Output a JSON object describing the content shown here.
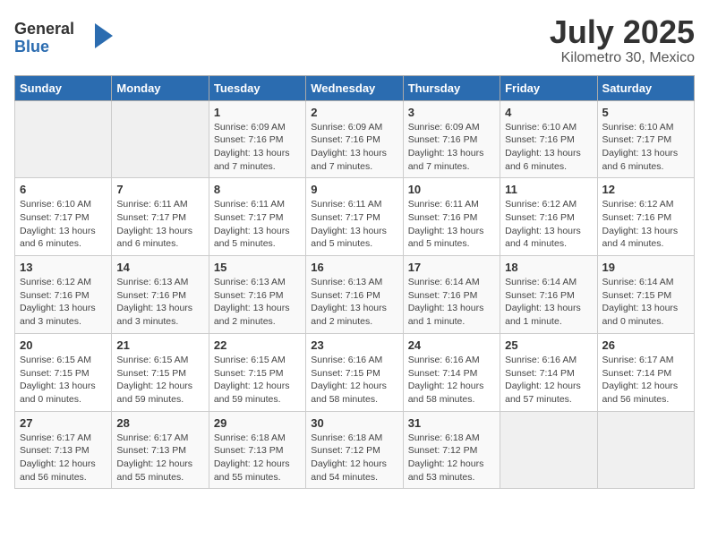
{
  "header": {
    "logo_line1": "General",
    "logo_line2": "Blue",
    "month_title": "July 2025",
    "subtitle": "Kilometro 30, Mexico"
  },
  "weekdays": [
    "Sunday",
    "Monday",
    "Tuesday",
    "Wednesday",
    "Thursday",
    "Friday",
    "Saturday"
  ],
  "weeks": [
    [
      {
        "day": "",
        "info": ""
      },
      {
        "day": "",
        "info": ""
      },
      {
        "day": "1",
        "info": "Sunrise: 6:09 AM\nSunset: 7:16 PM\nDaylight: 13 hours\nand 7 minutes."
      },
      {
        "day": "2",
        "info": "Sunrise: 6:09 AM\nSunset: 7:16 PM\nDaylight: 13 hours\nand 7 minutes."
      },
      {
        "day": "3",
        "info": "Sunrise: 6:09 AM\nSunset: 7:16 PM\nDaylight: 13 hours\nand 7 minutes."
      },
      {
        "day": "4",
        "info": "Sunrise: 6:10 AM\nSunset: 7:16 PM\nDaylight: 13 hours\nand 6 minutes."
      },
      {
        "day": "5",
        "info": "Sunrise: 6:10 AM\nSunset: 7:17 PM\nDaylight: 13 hours\nand 6 minutes."
      }
    ],
    [
      {
        "day": "6",
        "info": "Sunrise: 6:10 AM\nSunset: 7:17 PM\nDaylight: 13 hours\nand 6 minutes."
      },
      {
        "day": "7",
        "info": "Sunrise: 6:11 AM\nSunset: 7:17 PM\nDaylight: 13 hours\nand 6 minutes."
      },
      {
        "day": "8",
        "info": "Sunrise: 6:11 AM\nSunset: 7:17 PM\nDaylight: 13 hours\nand 5 minutes."
      },
      {
        "day": "9",
        "info": "Sunrise: 6:11 AM\nSunset: 7:17 PM\nDaylight: 13 hours\nand 5 minutes."
      },
      {
        "day": "10",
        "info": "Sunrise: 6:11 AM\nSunset: 7:16 PM\nDaylight: 13 hours\nand 5 minutes."
      },
      {
        "day": "11",
        "info": "Sunrise: 6:12 AM\nSunset: 7:16 PM\nDaylight: 13 hours\nand 4 minutes."
      },
      {
        "day": "12",
        "info": "Sunrise: 6:12 AM\nSunset: 7:16 PM\nDaylight: 13 hours\nand 4 minutes."
      }
    ],
    [
      {
        "day": "13",
        "info": "Sunrise: 6:12 AM\nSunset: 7:16 PM\nDaylight: 13 hours\nand 3 minutes."
      },
      {
        "day": "14",
        "info": "Sunrise: 6:13 AM\nSunset: 7:16 PM\nDaylight: 13 hours\nand 3 minutes."
      },
      {
        "day": "15",
        "info": "Sunrise: 6:13 AM\nSunset: 7:16 PM\nDaylight: 13 hours\nand 2 minutes."
      },
      {
        "day": "16",
        "info": "Sunrise: 6:13 AM\nSunset: 7:16 PM\nDaylight: 13 hours\nand 2 minutes."
      },
      {
        "day": "17",
        "info": "Sunrise: 6:14 AM\nSunset: 7:16 PM\nDaylight: 13 hours\nand 1 minute."
      },
      {
        "day": "18",
        "info": "Sunrise: 6:14 AM\nSunset: 7:16 PM\nDaylight: 13 hours\nand 1 minute."
      },
      {
        "day": "19",
        "info": "Sunrise: 6:14 AM\nSunset: 7:15 PM\nDaylight: 13 hours\nand 0 minutes."
      }
    ],
    [
      {
        "day": "20",
        "info": "Sunrise: 6:15 AM\nSunset: 7:15 PM\nDaylight: 13 hours\nand 0 minutes."
      },
      {
        "day": "21",
        "info": "Sunrise: 6:15 AM\nSunset: 7:15 PM\nDaylight: 12 hours\nand 59 minutes."
      },
      {
        "day": "22",
        "info": "Sunrise: 6:15 AM\nSunset: 7:15 PM\nDaylight: 12 hours\nand 59 minutes."
      },
      {
        "day": "23",
        "info": "Sunrise: 6:16 AM\nSunset: 7:15 PM\nDaylight: 12 hours\nand 58 minutes."
      },
      {
        "day": "24",
        "info": "Sunrise: 6:16 AM\nSunset: 7:14 PM\nDaylight: 12 hours\nand 58 minutes."
      },
      {
        "day": "25",
        "info": "Sunrise: 6:16 AM\nSunset: 7:14 PM\nDaylight: 12 hours\nand 57 minutes."
      },
      {
        "day": "26",
        "info": "Sunrise: 6:17 AM\nSunset: 7:14 PM\nDaylight: 12 hours\nand 56 minutes."
      }
    ],
    [
      {
        "day": "27",
        "info": "Sunrise: 6:17 AM\nSunset: 7:13 PM\nDaylight: 12 hours\nand 56 minutes."
      },
      {
        "day": "28",
        "info": "Sunrise: 6:17 AM\nSunset: 7:13 PM\nDaylight: 12 hours\nand 55 minutes."
      },
      {
        "day": "29",
        "info": "Sunrise: 6:18 AM\nSunset: 7:13 PM\nDaylight: 12 hours\nand 55 minutes."
      },
      {
        "day": "30",
        "info": "Sunrise: 6:18 AM\nSunset: 7:12 PM\nDaylight: 12 hours\nand 54 minutes."
      },
      {
        "day": "31",
        "info": "Sunrise: 6:18 AM\nSunset: 7:12 PM\nDaylight: 12 hours\nand 53 minutes."
      },
      {
        "day": "",
        "info": ""
      },
      {
        "day": "",
        "info": ""
      }
    ]
  ]
}
